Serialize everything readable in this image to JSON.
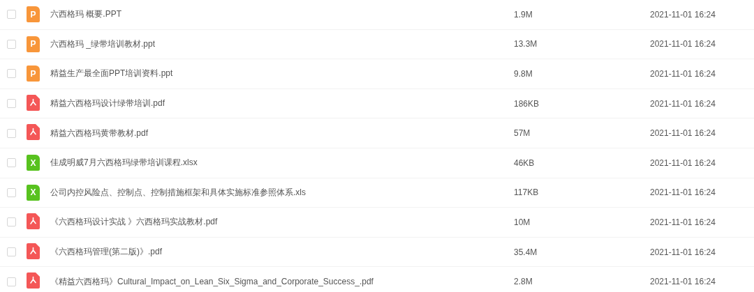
{
  "rows": [
    {
      "checked": false,
      "kind": "ppt",
      "icon_text": "P",
      "name": "六西格玛 概要.PPT",
      "size": "1.9M",
      "modified": "2021-11-01 16:24"
    },
    {
      "checked": false,
      "kind": "ppt",
      "icon_text": "P",
      "name": "六西格玛 _绿带培训教材.ppt",
      "size": "13.3M",
      "modified": "2021-11-01 16:24"
    },
    {
      "checked": false,
      "kind": "ppt",
      "icon_text": "P",
      "name": "精益生产最全面PPT培训资料.ppt",
      "size": "9.8M",
      "modified": "2021-11-01 16:24"
    },
    {
      "checked": false,
      "kind": "pdf",
      "name": "精益六西格玛设计绿带培训.pdf",
      "size": "186KB",
      "modified": "2021-11-01 16:24"
    },
    {
      "checked": false,
      "kind": "pdf",
      "name": "精益六西格玛黄带教材.pdf",
      "size": "57M",
      "modified": "2021-11-01 16:24"
    },
    {
      "checked": false,
      "kind": "xls",
      "icon_text": "X",
      "name": "佳成明威7月六西格玛绿带培训课程.xlsx",
      "size": "46KB",
      "modified": "2021-11-01 16:24"
    },
    {
      "checked": false,
      "kind": "xls",
      "icon_text": "X",
      "name": "公司内控风险点、控制点、控制措施框架和具体实施标准参照体系.xls",
      "size": "117KB",
      "modified": "2021-11-01 16:24"
    },
    {
      "checked": false,
      "kind": "pdf",
      "name": "《六西格玛设计实战 》六西格玛实战教材.pdf",
      "size": "10M",
      "modified": "2021-11-01 16:24"
    },
    {
      "checked": false,
      "kind": "pdf",
      "name": "《六西格玛管理(第二版)》.pdf",
      "size": "35.4M",
      "modified": "2021-11-01 16:24"
    },
    {
      "checked": false,
      "kind": "pdf",
      "name": "《精益六西格玛》Cultural_Impact_on_Lean_Six_Sigma_and_Corporate_Success_.pdf",
      "size": "2.8M",
      "modified": "2021-11-01 16:24"
    }
  ]
}
